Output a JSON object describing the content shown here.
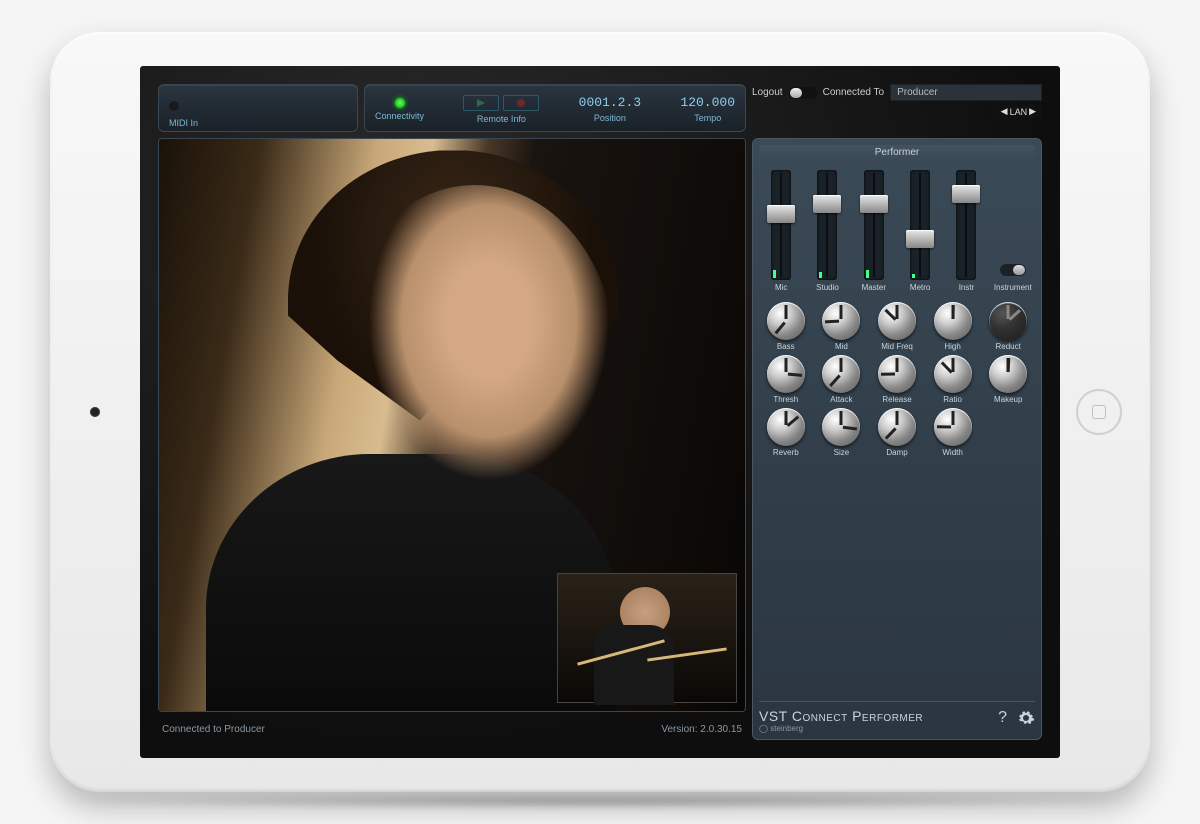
{
  "topbar": {
    "midi_label": "MIDI In",
    "connectivity": "Connectivity",
    "remote_info": "Remote Info",
    "position_label": "Position",
    "position_value": "0001.2.3",
    "tempo_label": "Tempo",
    "tempo_value": "120.000"
  },
  "connect": {
    "logout": "Logout",
    "connected_to": "Connected To",
    "peer": "Producer",
    "lan": "LAN"
  },
  "mixer": {
    "title": "Performer",
    "instrument": "Instrument",
    "faders": [
      {
        "label": "Mic",
        "pos": 35,
        "meter": 8
      },
      {
        "label": "Studio",
        "pos": 25,
        "meter": 6
      },
      {
        "label": "Master",
        "pos": 25,
        "meter": 8
      },
      {
        "label": "Metro",
        "pos": 60,
        "meter": 4
      },
      {
        "label": "Instr",
        "pos": 15,
        "meter": 0
      }
    ],
    "knob_rows": [
      [
        "Bass",
        "Mid",
        "Mid Freq",
        "High",
        "Reduct"
      ],
      [
        "Thresh",
        "Attack",
        "Release",
        "Ratio",
        "Makeup"
      ],
      [
        "Reverb",
        "Size",
        "Damp",
        "Width",
        ""
      ]
    ]
  },
  "brand": {
    "title": "VST Connect Performer",
    "sub": "steinberg"
  },
  "statusbar": {
    "left": "Connected to Producer",
    "right": "Version: 2.0.30.15"
  }
}
